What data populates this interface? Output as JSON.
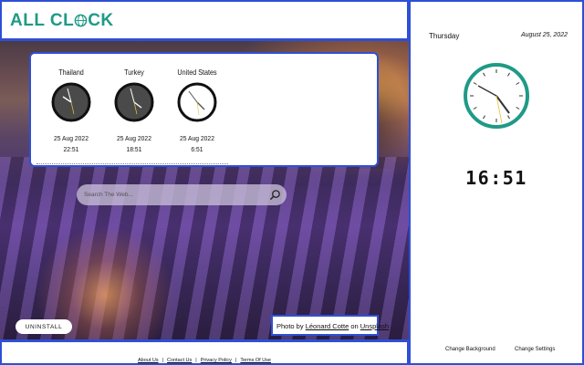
{
  "header": {
    "logo_text": "ALL CL",
    "logo_text_end": "CK"
  },
  "colors": {
    "accent": "#1f9a86",
    "border": "#2e4fd6"
  },
  "world_clocks": [
    {
      "country": "Thailand",
      "date": "25 Aug 2022",
      "time": "22:51",
      "theme": "dark"
    },
    {
      "country": "Turkey",
      "date": "25 Aug 2022",
      "time": "18:51",
      "theme": "dark"
    },
    {
      "country": "United States",
      "date": "25 Aug 2022",
      "time": "6:51",
      "theme": "light"
    }
  ],
  "search": {
    "placeholder": "Search The Web..."
  },
  "uninstall_label": "UNINSTALL",
  "credit": {
    "prefix": "Photo by ",
    "author": "Léonard Cotte",
    "middle": " on ",
    "source": "Unsplash"
  },
  "footer": {
    "links": [
      "About Us",
      "Contact Us",
      "Privacy Policy",
      "Terms Of Use"
    ]
  },
  "panel": {
    "day": "Thursday",
    "date": "August 25, 2022",
    "time": "16:51",
    "change_background": "Change Background",
    "change_settings": "Change Settings"
  }
}
